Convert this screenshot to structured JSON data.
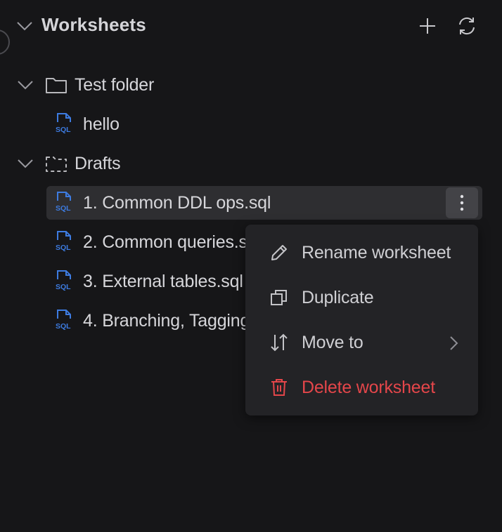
{
  "header": {
    "title": "Worksheets"
  },
  "tree": {
    "folders": [
      {
        "name": "Test folder",
        "files": [
          "hello"
        ]
      },
      {
        "name": "Drafts",
        "files": [
          "1. Common DDL ops.sql",
          "2. Common queries.s",
          "3. External tables.sql",
          "4. Branching, Tagging"
        ]
      }
    ]
  },
  "context_menu": {
    "items": [
      {
        "label": "Rename worksheet",
        "icon": "pencil-icon"
      },
      {
        "label": "Duplicate",
        "icon": "duplicate-icon"
      },
      {
        "label": "Move to",
        "icon": "sort-arrows-icon"
      },
      {
        "label": "Delete worksheet",
        "icon": "trash-icon"
      }
    ]
  },
  "colors": {
    "background": "#161618",
    "active_row": "#2e2e31",
    "menu_bg": "#232326",
    "danger": "#e4464a",
    "sql_icon": "#3d7be0"
  }
}
